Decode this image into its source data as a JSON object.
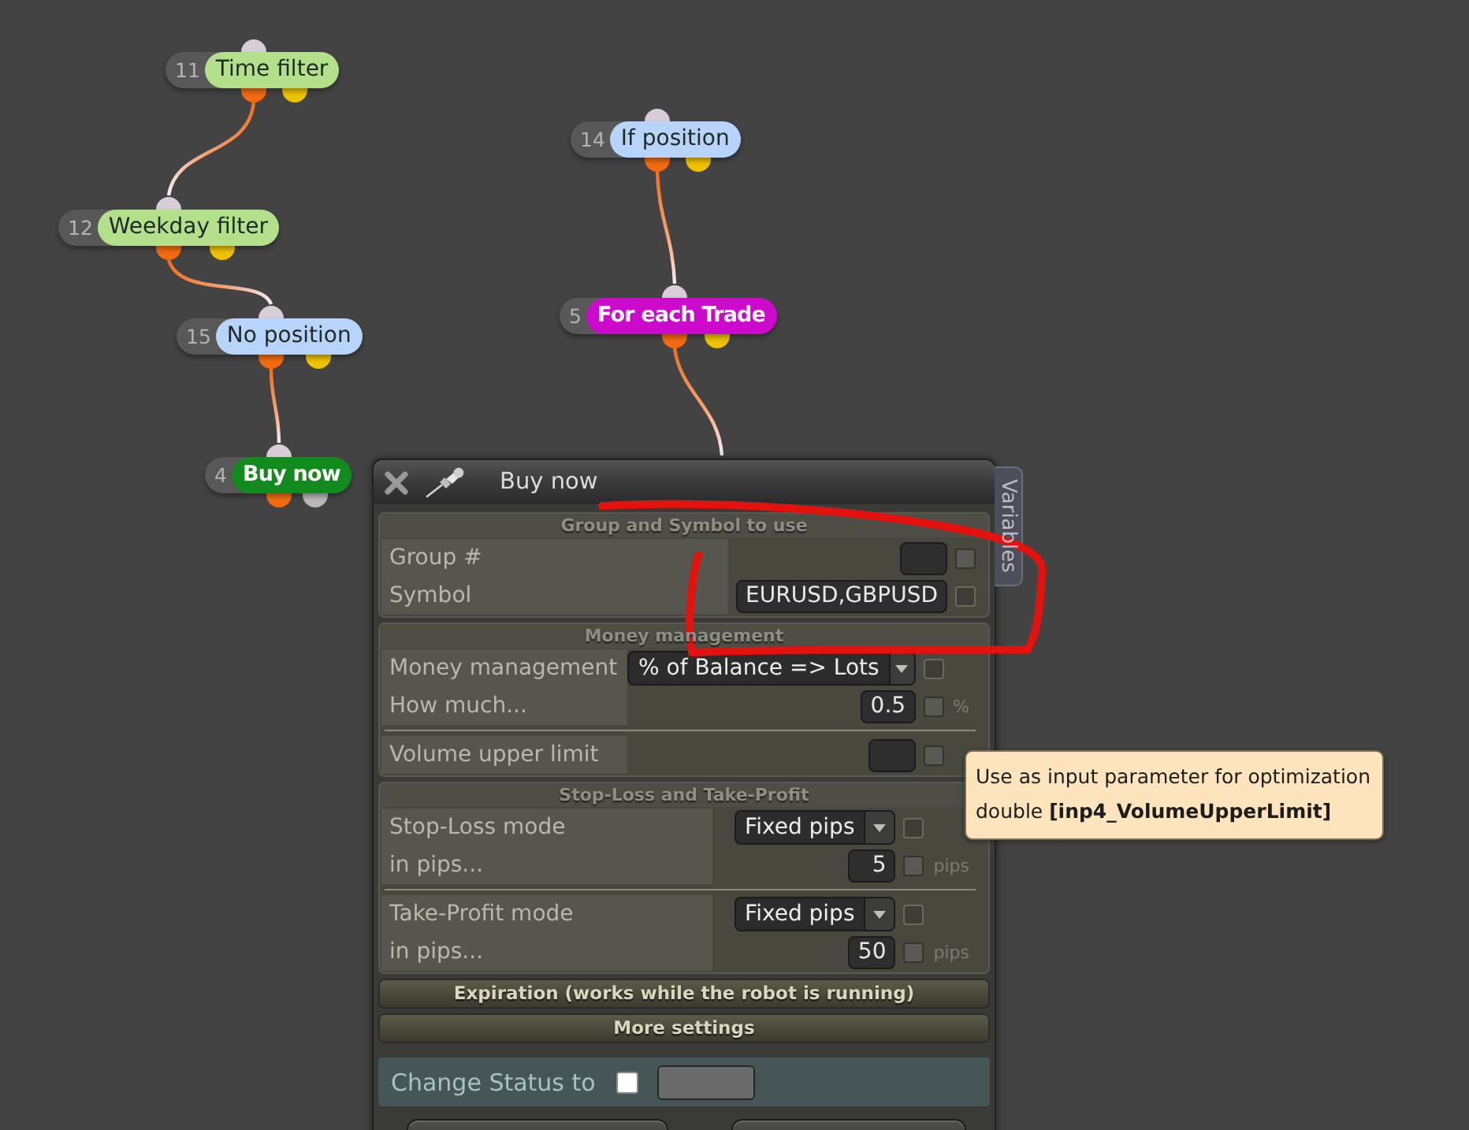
{
  "canvas": {
    "nodes": [
      {
        "number": "11",
        "label": "Time filter",
        "kind": "condition",
        "color": "#b4e08c",
        "ports": [
          {
            "color": "#f26b12"
          },
          {
            "color": "#eec200"
          }
        ]
      },
      {
        "number": "12",
        "label": "Weekday filter",
        "kind": "condition",
        "color": "#b4e08c",
        "ports": [
          {
            "color": "#f26b12"
          },
          {
            "color": "#eec200"
          }
        ]
      },
      {
        "number": "15",
        "label": "No position",
        "kind": "condition",
        "color": "#b9d4fa",
        "ports": [
          {
            "color": "#f26b12"
          },
          {
            "color": "#eec200"
          }
        ]
      },
      {
        "number": "4",
        "label": "Buy now",
        "kind": "action",
        "color": "#138a1e",
        "ports": [
          {
            "color": "#f26b12"
          },
          {
            "color": "#b8b8b8"
          }
        ]
      },
      {
        "number": "14",
        "label": "If position",
        "kind": "condition",
        "color": "#b9d4fa",
        "ports": [
          {
            "color": "#f26b12"
          },
          {
            "color": "#eec200"
          }
        ]
      },
      {
        "number": "5",
        "label": "For each Trade",
        "kind": "action",
        "color": "#cc0acc",
        "ports": [
          {
            "color": "#f26b12"
          },
          {
            "color": "#eec200"
          }
        ]
      }
    ]
  },
  "panel": {
    "title": "Buy now",
    "side_tab": "Variables",
    "sections": [
      {
        "title": "Group and Symbol to use",
        "expanded": true,
        "groups": [
          {
            "rows": [
              {
                "kind": "input",
                "label": "Group #",
                "checkbox": {
                  "checked": false,
                  "disabled": false
                }
              },
              {
                "kind": "input",
                "label": "Symbol",
                "value": "EURUSD,GBPUSD",
                "checkbox": {
                  "checked": false,
                  "disabled": true
                }
              }
            ]
          }
        ]
      },
      {
        "title": "Money management",
        "expanded": true,
        "groups": [
          {
            "rows": [
              {
                "kind": "dropdown",
                "label": "Money management",
                "value": "% of Balance => Lots",
                "checkbox": {
                  "checked": false,
                  "disabled": true
                }
              },
              {
                "kind": "input",
                "label": "How much...",
                "value": "0.5",
                "unit": "%",
                "checkbox": {
                  "checked": false,
                  "disabled": false
                }
              }
            ]
          },
          {
            "rows": [
              {
                "kind": "input",
                "label": "Volume upper limit",
                "checkbox": {
                  "checked": false,
                  "disabled": false
                }
              }
            ]
          }
        ]
      },
      {
        "title": "Stop-Loss and Take-Profit",
        "expanded": true,
        "groups": [
          {
            "rows": [
              {
                "kind": "dropdown",
                "label": "Stop-Loss mode",
                "value": "Fixed pips",
                "checkbox": {
                  "checked": false,
                  "disabled": true
                }
              },
              {
                "kind": "input",
                "label": "in pips...",
                "value": "5",
                "unit": "pips",
                "checkbox": {
                  "checked": false,
                  "disabled": false
                }
              }
            ]
          },
          {
            "rows": [
              {
                "kind": "dropdown",
                "label": "Take-Profit mode",
                "value": "Fixed pips",
                "checkbox": {
                  "checked": false,
                  "disabled": true
                }
              },
              {
                "kind": "input",
                "label": "in pips...",
                "value": "50",
                "unit": "pips",
                "checkbox": {
                  "checked": false,
                  "disabled": false
                }
              }
            ]
          }
        ]
      },
      {
        "title": "Expiration (works while the robot is running)",
        "expanded": false
      },
      {
        "title": "More settings",
        "expanded": false
      }
    ],
    "status_row": {
      "label": "Change Status to",
      "checked": false
    },
    "footer_buttons": [
      {
        "kind": "confirm"
      },
      {
        "kind": "cancel"
      }
    ]
  },
  "tooltip": {
    "lines": [
      "Use as input parameter for optimization",
      "double **[inp4_VolumeUpperLimit]**"
    ]
  }
}
